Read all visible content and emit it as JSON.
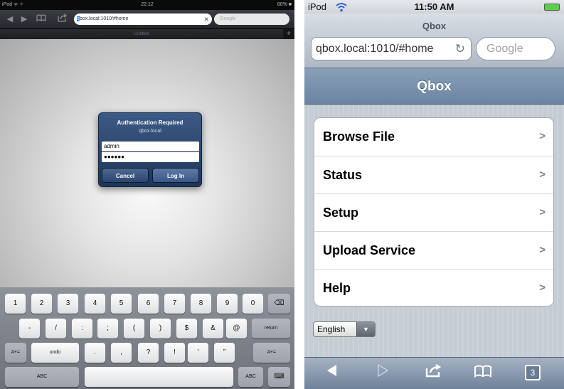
{
  "ipad": {
    "status": {
      "carrier": "iPod ᯤ ✧",
      "time": "22:12",
      "battery": "80% ■"
    },
    "url_selected": "q",
    "url_rest": "box.local:1010/#home",
    "search_placeholder": "Google",
    "tab_title": "Untitled",
    "dialog": {
      "title": "Authentication Required",
      "host": "qbox.local",
      "username": "admin",
      "password": "●●●●●●",
      "cancel": "Cancel",
      "login": "Log In"
    },
    "keyboard": {
      "row1": [
        "1",
        "2",
        "3",
        "4",
        "5",
        "6",
        "7",
        "8",
        "9",
        "0"
      ],
      "backspace": "⌫",
      "row2": [
        "-",
        "/",
        ":",
        ";",
        "(",
        ")",
        "$",
        "&",
        "@"
      ],
      "return": "return",
      "row3_left": "#+=",
      "undo": "undo",
      "row3": [
        ".",
        ",",
        "?",
        "!",
        "’",
        "”"
      ],
      "row3_right": "#+=",
      "abc_left": "ABC",
      "abc_right": "ABC",
      "hide": "⌨"
    }
  },
  "ipod": {
    "status": {
      "carrier": "iPod",
      "time": "11:50 AM"
    },
    "page_title": "Qbox",
    "url": "qbox.local:1010/#home",
    "search_placeholder": "Google",
    "nav_title": "Qbox",
    "menu": [
      {
        "label": "Browse File"
      },
      {
        "label": "Status"
      },
      {
        "label": "Setup"
      },
      {
        "label": "Upload Service"
      },
      {
        "label": "Help"
      }
    ],
    "chevron": ">",
    "language": "English",
    "tabs_count": "3"
  }
}
